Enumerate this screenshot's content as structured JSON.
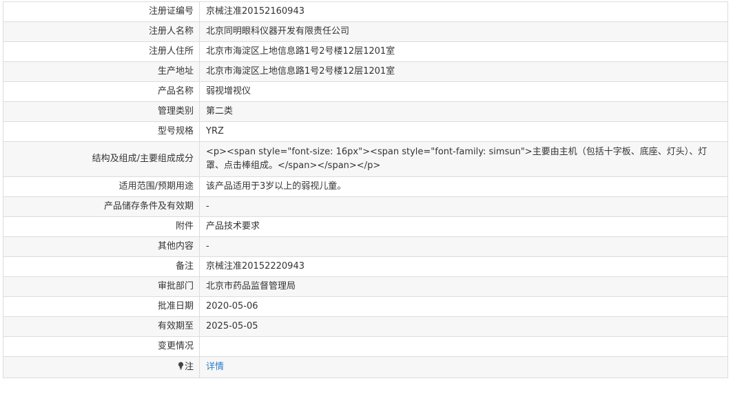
{
  "rows": [
    {
      "label": "注册证编号",
      "value": "京械注准20152160943"
    },
    {
      "label": "注册人名称",
      "value": "北京同明眼科仪器开发有限责任公司"
    },
    {
      "label": "注册人住所",
      "value": "北京市海淀区上地信息路1号2号楼12层1201室"
    },
    {
      "label": "生产地址",
      "value": "北京市海淀区上地信息路1号2号楼12层1201室"
    },
    {
      "label": "产品名称",
      "value": "弱视增视仪"
    },
    {
      "label": "管理类别",
      "value": "第二类"
    },
    {
      "label": "型号规格",
      "value": "YRZ"
    },
    {
      "label": "结构及组成/主要组成成分",
      "value": "<p><span style=\"font-size: 16px\"><span style=\"font-family: simsun\">主要由主机（包括十字板、底座、灯头）、灯罩、点击棒组成。</span></span></p>"
    },
    {
      "label": "适用范围/预期用途",
      "value": "该产品适用于3岁以上的弱视儿童。"
    },
    {
      "label": "产品储存条件及有效期",
      "value": "-"
    },
    {
      "label": "附件",
      "value": "产品技术要求"
    },
    {
      "label": "其他内容",
      "value": "-"
    },
    {
      "label": "备注",
      "value": "京械注准20152220943"
    },
    {
      "label": "审批部门",
      "value": "北京市药品监督管理局"
    },
    {
      "label": "批准日期",
      "value": "2020-05-06"
    },
    {
      "label": "有效期至",
      "value": "2025-05-05"
    },
    {
      "label": "变更情况",
      "value": ""
    }
  ],
  "note_row": {
    "label": "注",
    "icon": "lightbulb-icon",
    "link_label": "详情"
  },
  "colors": {
    "border": "#dcdcdc",
    "stripe": "#f7f7f7",
    "link": "#2a7ec9",
    "text": "#333333"
  }
}
